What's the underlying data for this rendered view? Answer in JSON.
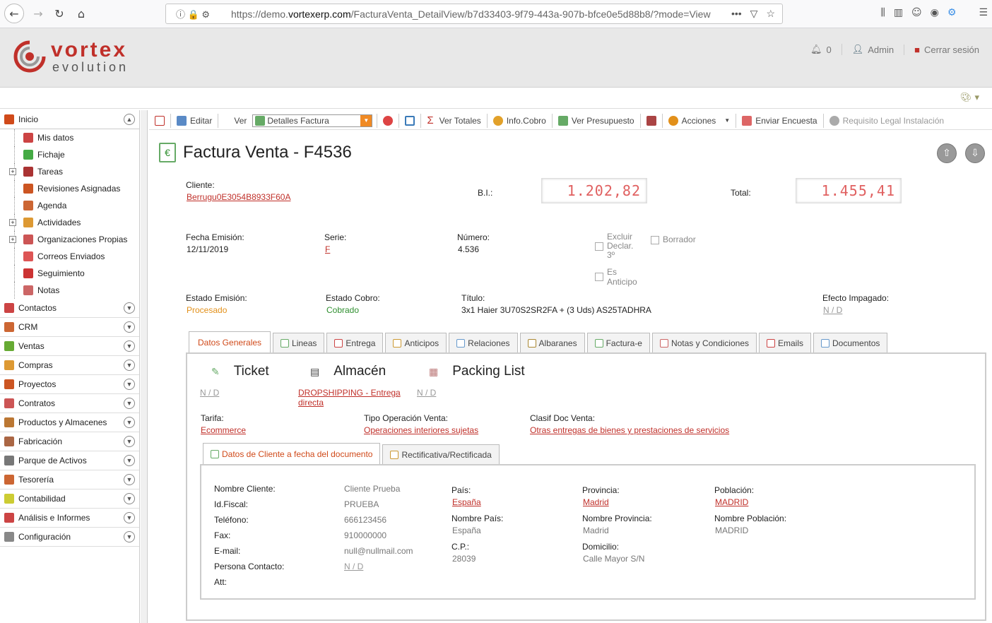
{
  "browser": {
    "url_prefix": "https://demo.",
    "url_domain": "vortexerp.com",
    "url_path": "/FacturaVenta_DetailView/b7d33403-9f79-443a-907b-bfce0e5d88b8/?mode=View"
  },
  "header": {
    "logo_line1": "vortex",
    "logo_line2": "evolution",
    "notifications_count": "0",
    "user_label": "Admin",
    "logout_label": "Cerrar sesión"
  },
  "sidebar": {
    "inicio": "Inicio",
    "sub_items": [
      "Mis datos",
      "Fichaje",
      "Tareas",
      "Revisiones Asignadas",
      "Agenda",
      "Actividades",
      "Organizaciones Propias",
      "Correos Enviados",
      "Seguimiento",
      "Notas"
    ],
    "sections": [
      "Contactos",
      "CRM",
      "Ventas",
      "Compras",
      "Proyectos",
      "Contratos",
      "Productos y Almacenes",
      "Fabricación",
      "Parque de Activos",
      "Tesorería",
      "Contabilidad",
      "Análisis e Informes",
      "Configuración"
    ]
  },
  "toolbar": {
    "edit": "Editar",
    "view_label": "Ver",
    "view_select": "Detalles Factura",
    "totals": "Ver Totales",
    "collection": "Info.Cobro",
    "quote": "Ver Presupuesto",
    "actions": "Acciones",
    "survey": "Enviar Encuesta",
    "legal": "Requisito Legal Instalación"
  },
  "invoice": {
    "title": "Factura Venta - F4536",
    "client_label": "Cliente:",
    "client_value": "Berrugu0E3054B8933F60A",
    "bi_label": "B.I.:",
    "bi_value": "1.202,82",
    "total_label": "Total:",
    "total_value": "1.455,41",
    "date_label": "Fecha Emisión:",
    "date_value": "12/11/2019",
    "series_label": "Serie:",
    "series_value": "F",
    "number_label": "Número:",
    "number_value": "4.536",
    "exclude_label_1": "Excluir",
    "exclude_label_2": "Declar.",
    "exclude_label_3": "3º",
    "draft_label": "Borrador",
    "advance_label_1": "Es",
    "advance_label_2": "Anticipo",
    "emission_state_label": "Estado Emisión:",
    "emission_state_value": "Procesado",
    "collection_state_label": "Estado Cobro:",
    "collection_state_value": "Cobrado",
    "title_field_label": "Título:",
    "title_field_value": "3x1 Haier 3U70S2SR2FA + (3 Uds) AS25TADHRA",
    "unpaid_label": "Efecto Impagado:",
    "unpaid_value": "N / D"
  },
  "tabs": [
    "Datos Generales",
    "Lineas",
    "Entrega",
    "Anticipos",
    "Relaciones",
    "Albaranes",
    "Factura-e",
    "Notas y Condiciones",
    "Emails",
    "Documentos"
  ],
  "general": {
    "ticket_label": "Ticket",
    "ticket_value": "N / D",
    "warehouse_label": "Almacén",
    "warehouse_value_1": "DROPSHIPPING - Entrega",
    "warehouse_value_2": "directa",
    "packing_label": "Packing List",
    "packing_value": "N / D",
    "tarifa_label": "Tarifa:",
    "tarifa_value": "Ecommerce",
    "op_label": "Tipo Operación Venta:",
    "op_value": "Operaciones interiores sujetas",
    "clasif_label": "Clasif Doc Venta:",
    "clasif_value": "Otras entregas de bienes y prestaciones de servicios"
  },
  "subtabs": [
    "Datos de Cliente a fecha del documento",
    "Rectificativa/Rectificada"
  ],
  "client_data": {
    "name_label": "Nombre Cliente:",
    "name_value": "Cliente Prueba",
    "taxid_label": "Id.Fiscal:",
    "taxid_value": "PRUEBA",
    "phone_label": "Teléfono:",
    "phone_value": "666123456",
    "fax_label": "Fax:",
    "fax_value": "910000000",
    "email_label": "E-mail:",
    "email_value": "null@nullmail.com",
    "contact_label": "Persona Contacto:",
    "contact_value": "N / D",
    "att_label": "Att:",
    "country_label": "País:",
    "country_value": "España",
    "country_name_label": "Nombre País:",
    "country_name_value": "España",
    "cp_label": "C.P.:",
    "cp_value": "28039",
    "province_label": "Provincia:",
    "province_value": "Madrid",
    "province_name_label": "Nombre Provincia:",
    "province_name_value": "Madrid",
    "address_label": "Domicilio:",
    "address_value": "Calle Mayor S/N",
    "town_label": "Población:",
    "town_value": "MADRID",
    "town_name_label": "Nombre Población:",
    "town_name_value": "MADRID"
  }
}
